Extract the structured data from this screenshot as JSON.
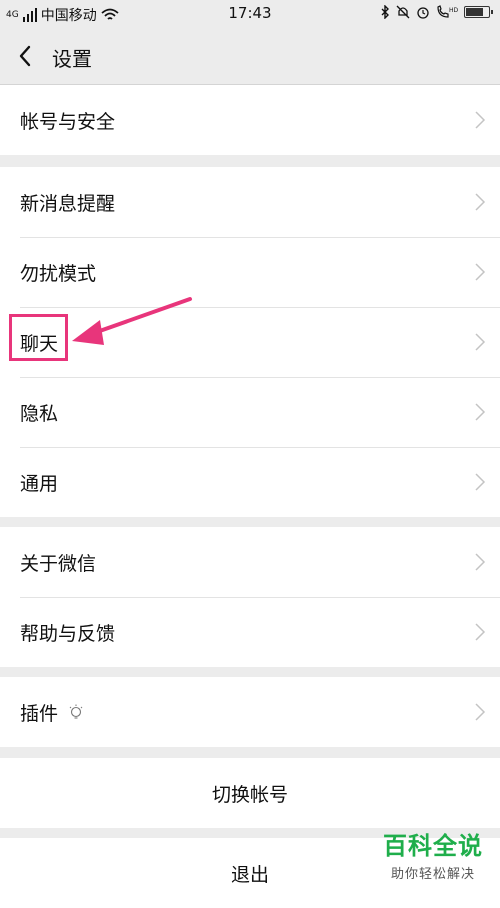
{
  "status_bar": {
    "carrier": "中国移动",
    "time": "17:43",
    "signal_label": "4G",
    "battery_level": 0.8
  },
  "nav": {
    "title": "设置"
  },
  "groups": [
    {
      "items": [
        "帐号与安全"
      ]
    },
    {
      "items": [
        "新消息提醒",
        "勿扰模式",
        "聊天",
        "隐私",
        "通用"
      ]
    },
    {
      "items": [
        "关于微信",
        "帮助与反馈"
      ]
    },
    {
      "items": [
        "插件"
      ]
    },
    {
      "items": [
        "切换帐号"
      ]
    },
    {
      "items": [
        "退出"
      ]
    }
  ],
  "watermark": {
    "title": "百科全说",
    "subtitle": "助你轻松解决"
  },
  "colors": {
    "highlight": "#e8357b",
    "watermark": "#1fae4b"
  }
}
